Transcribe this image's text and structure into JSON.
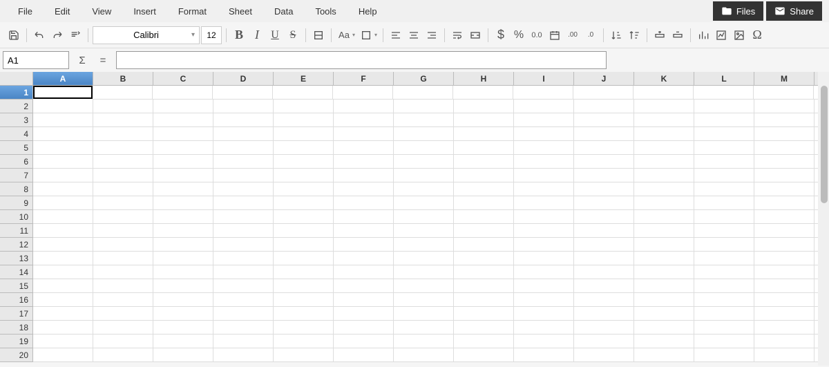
{
  "menu": {
    "items": [
      "File",
      "Edit",
      "View",
      "Insert",
      "Format",
      "Sheet",
      "Data",
      "Tools",
      "Help"
    ]
  },
  "header_buttons": {
    "files": "Files",
    "share": "Share"
  },
  "toolbar": {
    "font_name": "Calibri",
    "font_size": "12",
    "bold": "B",
    "italic": "I",
    "underline": "U",
    "strike": "S",
    "aa": "Aa",
    "currency": "$",
    "percent": "%",
    "number_fmt": "0.0",
    "add_decimal": "00",
    "remove_decimal": "0"
  },
  "formula": {
    "cell_ref": "A1",
    "sigma": "Σ",
    "equals": "=",
    "content": ""
  },
  "grid": {
    "columns": [
      "A",
      "B",
      "C",
      "D",
      "E",
      "F",
      "G",
      "H",
      "I",
      "J",
      "K",
      "L",
      "M"
    ],
    "rows": [
      "1",
      "2",
      "3",
      "4",
      "5",
      "6",
      "7",
      "8",
      "9",
      "10",
      "11",
      "12",
      "13",
      "14",
      "15",
      "16",
      "17",
      "18",
      "19",
      "20"
    ],
    "selected_col": 0,
    "selected_row": 0,
    "active_cell": "A1"
  }
}
